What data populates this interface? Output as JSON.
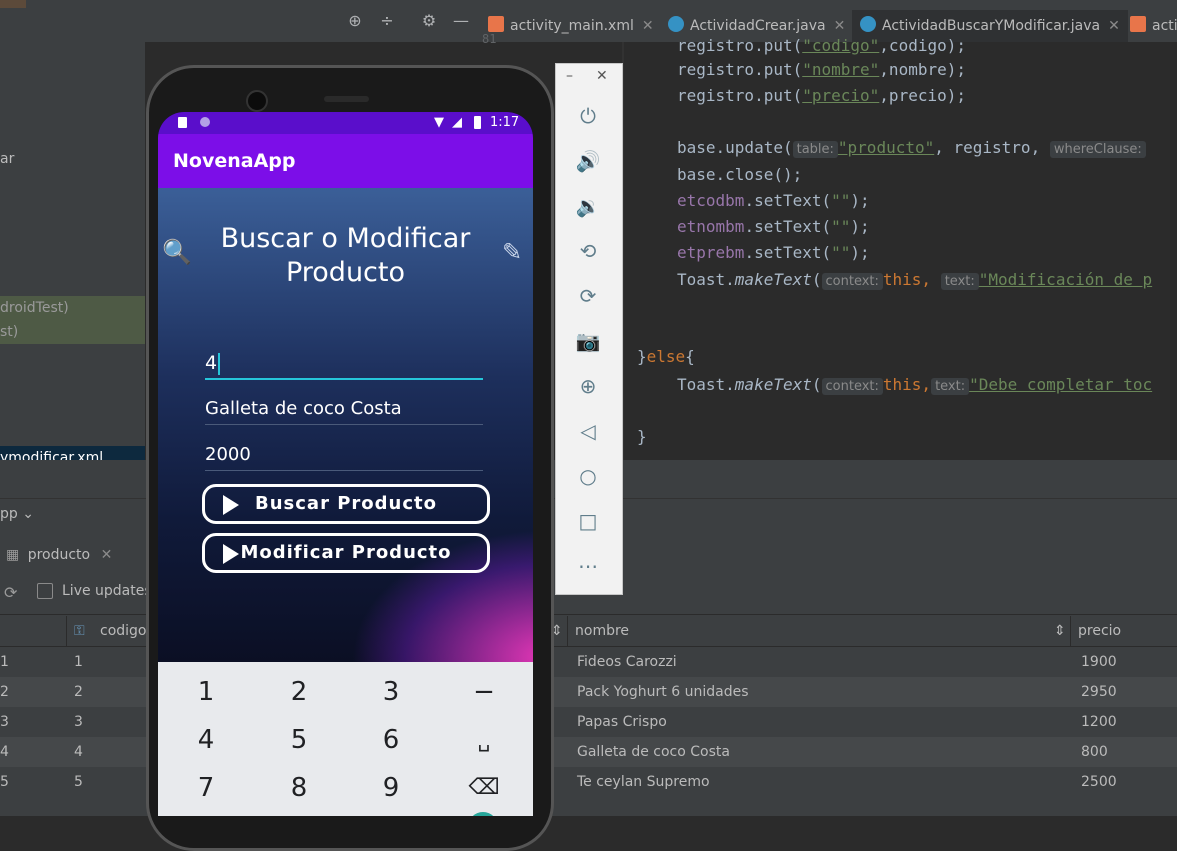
{
  "ide": {
    "tabs": [
      {
        "label": "activity_main.xml",
        "icon": "xml-file-icon",
        "color": "#e8754a"
      },
      {
        "label": "ActividadCrear.java",
        "icon": "java-class-icon",
        "color": "#3592c4"
      },
      {
        "label": "ActividadBuscarYModificar.java",
        "icon": "java-class-icon",
        "color": "#3592c4"
      },
      {
        "label": "acti",
        "icon": "xml-file-icon",
        "color": "#e8754a"
      }
    ],
    "left_panel": {
      "item_ar": "ar",
      "item_android_test": "droidTest)",
      "item_test": "st)",
      "item_xml": "ymodificar.xml",
      "app_selector": "pp"
    },
    "db_panel": {
      "table_tab": "producto",
      "live_updates": "Live updates",
      "columns": {
        "codigo": "codigo",
        "nombre": "nombre",
        "precio": "precio"
      },
      "rows": [
        {
          "idx": "1",
          "codigo": "1",
          "nombre": "Fideos Carozzi",
          "precio": "1900"
        },
        {
          "idx": "2",
          "codigo": "2",
          "nombre": "Pack Yoghurt 6 unidades",
          "precio": "2950"
        },
        {
          "idx": "3",
          "codigo": "3",
          "nombre": "Papas Crispo",
          "precio": "1200"
        },
        {
          "idx": "4",
          "codigo": "4",
          "nombre": "Galleta de coco Costa",
          "precio": "800"
        },
        {
          "idx": "5",
          "codigo": "5",
          "nombre": "Te ceylan Supremo",
          "precio": "2500"
        }
      ]
    },
    "code": {
      "line_number": "81",
      "l1_a": "registro.put(",
      "l1_str": "\"codigo\"",
      "l1_b": ",codigo);",
      "l2_a": "registro.put(",
      "l2_str": "\"nombre\"",
      "l2_b": ",nombre);",
      "l3_a": "registro.put(",
      "l3_str": "\"precio\"",
      "l3_b": ",precio);",
      "l4_a": "base.update(",
      "l4_hint1": "table:",
      "l4_str": "\"producto\"",
      "l4_b": ", registro, ",
      "l4_hint2": "whereClause:",
      "l5": "base.close();",
      "l6_f": "etcodbm",
      "l6_b": ".setText(",
      "l6_s": "\"\"",
      "l6_c": ");",
      "l7_f": "etnombm",
      "l7_b": ".setText(",
      "l7_s": "\"\"",
      "l7_c": ");",
      "l8_f": "etprebm",
      "l8_b": ".setText(",
      "l8_s": "\"\"",
      "l8_c": ");",
      "l9_a": "Toast.",
      "l9_m": "makeText",
      "l9_b": "(",
      "l9_hint1": "context:",
      "l9_kw": "this,",
      "l9_hint2": "text:",
      "l9_str": "\"Modificación de p",
      "l10_a": "}",
      "l10_kw": "else",
      "l10_b": "{",
      "l11_a": "Toast.",
      "l11_m": "makeText",
      "l11_b": "(",
      "l11_hint1": "context:",
      "l11_kw": "this,",
      "l11_hint2": "text:",
      "l11_str": "\"Debe completar toc",
      "l12": "}"
    }
  },
  "phone": {
    "time": "1:17",
    "app_title": "NovenaApp",
    "heading": "Buscar o Modificar Producto",
    "codigo_value": "4",
    "nombre_value": "Galleta de coco Costa",
    "precio_value": "2000",
    "buscar_button": "Buscar Producto",
    "modificar_button": "Modificar Producto",
    "keyboard": {
      "row1": [
        "1",
        "2",
        "3",
        "−"
      ],
      "row2": [
        "4",
        "5",
        "6",
        "␣"
      ],
      "row3": [
        "7",
        "8",
        "9",
        "⌫"
      ]
    }
  },
  "colors": {
    "accent_purple": "#7c0ee8",
    "status_purple": "#5a0ecb",
    "input_underline": "#26c6da",
    "ide_background": "#2b2b2b"
  }
}
